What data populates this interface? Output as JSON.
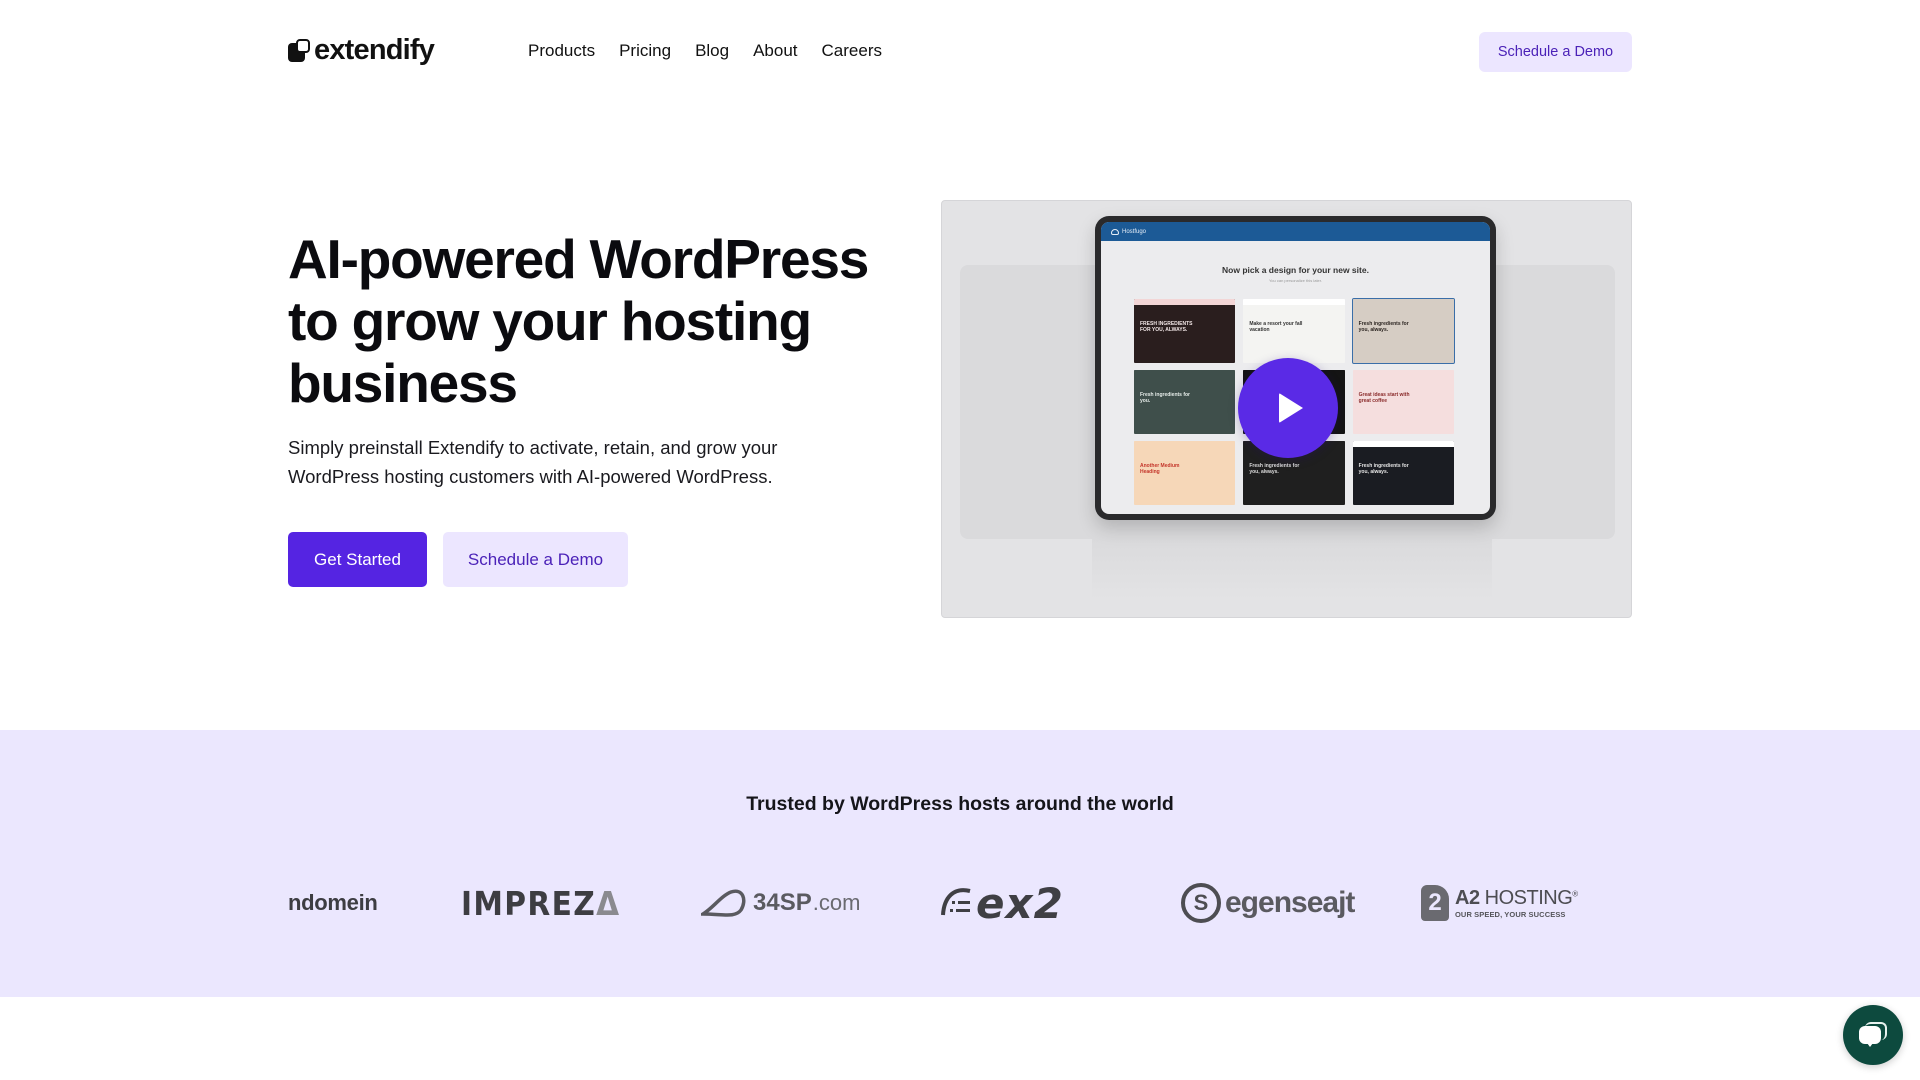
{
  "header": {
    "logo_text": "extendify",
    "nav": [
      {
        "label": "Products"
      },
      {
        "label": "Pricing"
      },
      {
        "label": "Blog"
      },
      {
        "label": "About"
      },
      {
        "label": "Careers"
      }
    ],
    "cta_label": "Schedule a Demo"
  },
  "hero": {
    "title": "AI-powered WordPress to grow your hosting business",
    "subtitle": "Simply preinstall Extendify to activate, retain, and grow your WordPress hosting customers with AI-powered WordPress.",
    "primary_button": "Get Started",
    "secondary_button": "Schedule a Demo"
  },
  "video": {
    "play_icon": "play-icon",
    "preview": {
      "brand": "Hostfugo",
      "heading": "Now pick a design for your new site.",
      "subheading": "You can personalize this later.",
      "tiles": [
        {
          "title": "FRESH INGREDIENTS FOR YOU, ALWAYS.",
          "bg": "#2a1e1e",
          "bar": "#f3d6d6",
          "fg": "#f1e6e6"
        },
        {
          "title": "Make a resort your fall vacation",
          "bg": "#f4f4f2",
          "bar": "#ffffff",
          "fg": "#333333"
        },
        {
          "title": "Fresh ingredients for you, always.",
          "bg": "#d6cdc4",
          "bar": "#d6cdc4",
          "fg": "#2b2420",
          "selected": true
        },
        {
          "title": "Fresh ingredients for you.",
          "bg": "#3f4f4b",
          "bar": "#3f4f4b",
          "fg": "#e6ece9"
        },
        {
          "title": "",
          "bg": "#141414",
          "bar": "#141414",
          "fg": "#cccccc"
        },
        {
          "title": "Great ideas start with great coffee",
          "bg": "#f5dede",
          "bar": "#f5dede",
          "fg": "#8a2b2b"
        },
        {
          "title": "Another Medium Heading",
          "bg": "#f6d7b8",
          "bar": "#f6d7b8",
          "fg": "#c4352a"
        },
        {
          "title": "Fresh ingredients for you, always.",
          "bg": "#1f1f1f",
          "bar": "#1f1f1f",
          "fg": "#dddddd"
        },
        {
          "title": "Fresh ingredients for you, always.",
          "bg": "#1a1c22",
          "bar": "#ffffff",
          "fg": "#e6e6e6"
        }
      ]
    }
  },
  "trusted": {
    "title": "Trusted by WordPress hosts around the world",
    "logos": [
      {
        "name": "ndomein",
        "text": "ndomein"
      },
      {
        "name": "impreza",
        "text": "IMPREZ",
        "accent": "Δ"
      },
      {
        "name": "34sp",
        "text": "34SP",
        "suffix": ".com"
      },
      {
        "name": "ex2",
        "text": "ex2"
      },
      {
        "name": "egenseajt",
        "text": "egenseajt",
        "mark": "S"
      },
      {
        "name": "a2-hosting",
        "text_bold": "A2",
        "text": " HOSTING",
        "registered": "®",
        "tagline": "OUR SPEED, YOUR SUCCESS",
        "mark": "2"
      }
    ]
  },
  "chat": {
    "icon": "chat-bubble-icon"
  },
  "colors": {
    "primary": "#5524e2",
    "primary_light": "#ece6ff",
    "primary_text": "#4b22b8",
    "trusted_bg": "#ebe7fe",
    "chat_bg": "#0d4a3e",
    "tablet_header": "#1c5a96"
  }
}
